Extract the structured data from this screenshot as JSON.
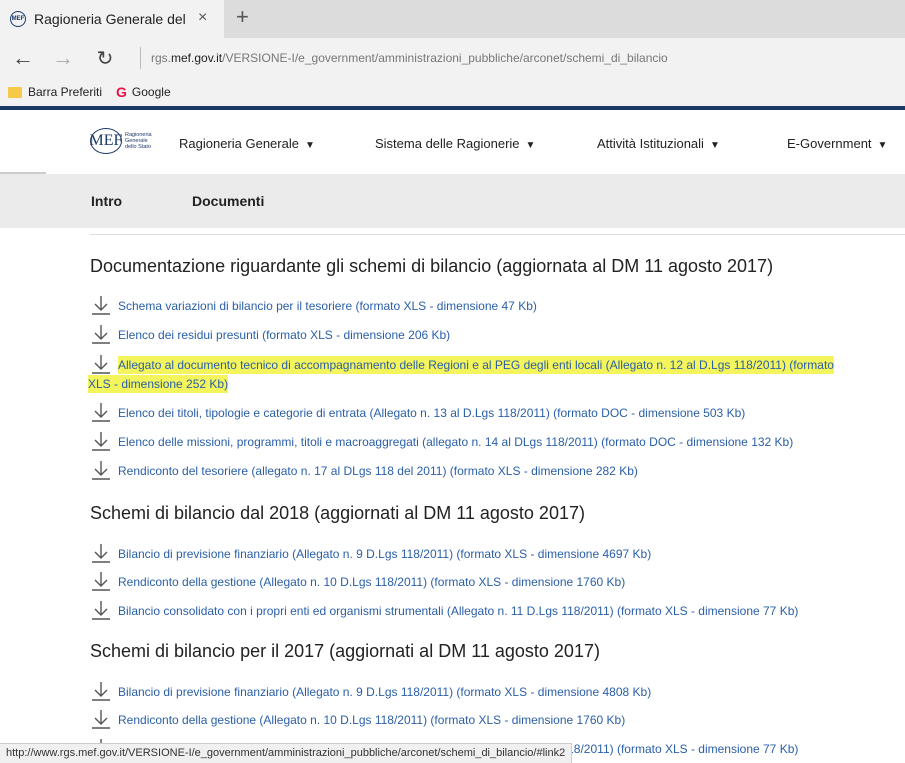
{
  "browser": {
    "tab_title": "Ragioneria Generale del",
    "tab_close": "×",
    "new_tab": "+",
    "back": "←",
    "forward": "→",
    "refresh": "↻",
    "url_prefix": "rgs.",
    "url_domain": "mef.gov.it",
    "url_path": "/VERSIONE-I/e_government/amministrazioni_pubbliche/arconet/schemi_di_bilancio",
    "favorites": [
      {
        "label": "Barra Preferiti"
      },
      {
        "label": "Google"
      }
    ]
  },
  "header": {
    "logo_mef": "MEF",
    "logo_text": "Ragioneria Generale dello Stato",
    "menu": [
      {
        "label": "Ragioneria Generale"
      },
      {
        "label": "Sistema delle Ragionerie"
      },
      {
        "label": "Attività Istituzionali"
      },
      {
        "label": "E-Government"
      }
    ],
    "caret": "▼"
  },
  "subnav": [
    {
      "label": "Intro"
    },
    {
      "label": "Documenti"
    }
  ],
  "sections": [
    {
      "title": "Documentazione riguardante gli schemi di bilancio (aggiornata al DM 11 agosto 2017)",
      "items": [
        {
          "label": "Schema variazioni di bilancio per il tesoriere  (formato XLS - dimensione 47 Kb)"
        },
        {
          "label": "Elenco dei residui presunti (formato XLS - dimensione 206 Kb)"
        },
        {
          "label": "Allegato al documento tecnico di accompagnamento delle Regioni e al PEG degli enti locali (Allegato n. 12 al D.Lgs 118/2011)  (formato",
          "label_cont": "XLS - dimensione 252 Kb)"
        },
        {
          "label": "Elenco dei titoli, tipologie e categorie di entrata (Allegato n. 13 al D.Lgs 118/2011) (formato DOC - dimensione 503 Kb)"
        },
        {
          "label": "Elenco delle missioni, programmi, titoli e macroaggregati (allegato n. 14 al DLgs 118/2011) (formato DOC - dimensione 132 Kb)"
        },
        {
          "label": "Rendiconto del tesoriere (allegato n. 17 al DLgs 118 del 2011) (formato XLS - dimensione 282 Kb)"
        }
      ]
    },
    {
      "title": "Schemi di bilancio dal 2018 (aggiornati al DM 11 agosto 2017)",
      "items": [
        {
          "label": "Bilancio di previsione finanziario (Allegato n. 9 D.Lgs 118/2011) (formato XLS - dimensione 4697 Kb)"
        },
        {
          "label": "Rendiconto della gestione (Allegato n. 10 D.Lgs 118/2011) (formato XLS - dimensione 1760 Kb)"
        },
        {
          "label": "Bilancio consolidato con i propri enti ed organismi strumentali (Allegato n. 11 D.Lgs 118/2011) (formato XLS - dimensione 77 Kb)"
        }
      ]
    },
    {
      "title": "Schemi di bilancio per il 2017 (aggiornati al DM 11 agosto 2017)",
      "items": [
        {
          "label": "Bilancio di previsione finanziario (Allegato n. 9 D.Lgs 118/2011) (formato XLS - dimensione 4808 Kb)"
        },
        {
          "label": "Rendiconto della gestione (Allegato n. 10 D.Lgs 118/2011) (formato XLS - dimensione 1760 Kb)"
        },
        {
          "label": "Bilancio consolidato con i propri enti ed organismi strumentali (Allegato n. 11 D.Lgs 118/2011) (formato XLS - dimensione 77 Kb)"
        }
      ]
    }
  ],
  "statusbar": "http://www.rgs.mef.gov.it/VERSIONE-I/e_government/amministrazioni_pubbliche/arconet/schemi_di_bilancio/#link2",
  "colors": {
    "link": "#2a5fa8",
    "highlight": "#f4f45c",
    "brand": "#1d3a66"
  }
}
